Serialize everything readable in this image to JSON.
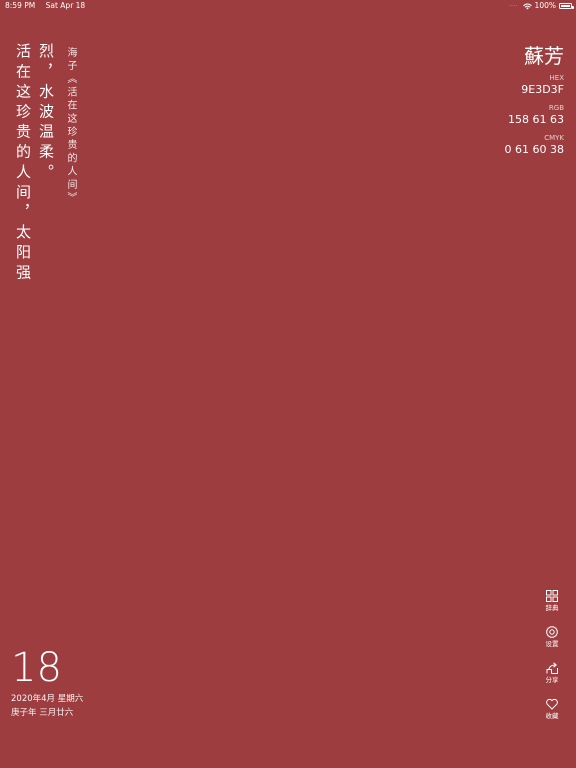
{
  "status_bar": {
    "time": "8:59 PM",
    "date": "Sat Apr 18",
    "battery": "100%"
  },
  "poem": {
    "lines": [
      "活在这珍贵的人间，太阳强",
      "烈，水波温柔。"
    ],
    "attribution": "海子《活在这珍贵的人间》"
  },
  "color": {
    "name": "蘇芳",
    "hex_label": "HEX",
    "hex": "9E3D3F",
    "rgb_label": "RGB",
    "rgb": "158 61 63",
    "cmyk_label": "CMYK",
    "cmyk": "0 61 60 38",
    "accent": "#9E3D3F"
  },
  "menu": {
    "dictionary": {
      "label": "辞典",
      "icon": "grid-icon"
    },
    "settings": {
      "label": "设置",
      "icon": "settings-icon"
    },
    "share": {
      "label": "分享",
      "icon": "share-icon"
    },
    "favorite": {
      "label": "收藏",
      "icon": "heart-icon"
    }
  },
  "date": {
    "day": "18",
    "gregorian": "2020年4月 星期六",
    "lunar": "庚子年 三月廿六"
  }
}
